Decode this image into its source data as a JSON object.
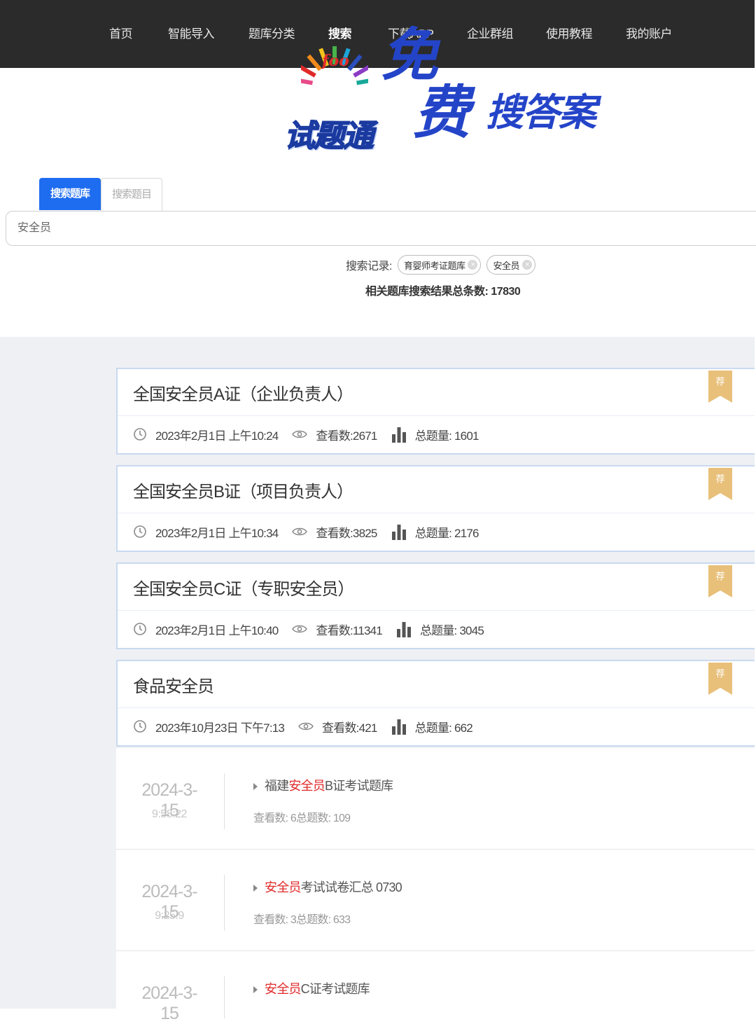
{
  "nav": {
    "items": [
      "首页",
      "智能导入",
      "题库分类",
      "搜索",
      "下载APP",
      "企业群组",
      "使用教程",
      "我的账户"
    ],
    "active_index": 3
  },
  "logo": {
    "brand_small": "foo",
    "brand_name": "试题通",
    "slogan_free_1": "免",
    "slogan_free_2": "费",
    "slogan_rest": "搜答案",
    "slogan_color": "#2444c8"
  },
  "search": {
    "tab_active": "搜索题库",
    "tab_inactive": "搜索题目",
    "query": "安全员",
    "history_label": "搜索记录:",
    "history": [
      "育婴师考证题库",
      "安全员"
    ],
    "total_label": "相关题库搜索结果总条数:",
    "total_value": "17830"
  },
  "featured": [
    {
      "title": "全国安全员A证（企业负责人）",
      "datetime": "2023年2月1日 上午10:24",
      "views": "查看数:2671",
      "count": "总题量:  1601",
      "badge": "荐"
    },
    {
      "title": "全国安全员B证（项目负责人）",
      "datetime": "2023年2月1日 上午10:34",
      "views": "查看数:3825",
      "count": "总题量:  2176",
      "badge": "荐"
    },
    {
      "title": "全国安全员C证（专职安全员）",
      "datetime": "2023年2月1日 上午10:40",
      "views": "查看数:11341",
      "count": "总题量:  3045",
      "badge": "荐"
    },
    {
      "title": "食品安全员",
      "datetime": "2023年10月23日 下午7:13",
      "views": "查看数:421",
      "count": "总题量:  662",
      "badge": "荐"
    }
  ],
  "results": [
    {
      "date": "2024-3-15",
      "time": "9:58:22",
      "prefix": "福建",
      "highlight": "安全员",
      "suffix": "B证考试题库",
      "meta": "查看数:  6总题数:  109"
    },
    {
      "date": "2024-3-15",
      "time": "9:25:9",
      "prefix": "",
      "highlight": "安全员",
      "suffix": "考试试卷汇总 0730",
      "meta": "查看数:  3总题数:  633"
    },
    {
      "date": "2024-3-15",
      "time": "",
      "prefix": "",
      "highlight": "安全员",
      "suffix": "C证考试题库",
      "meta": ""
    }
  ],
  "colors": {
    "nav_bg": "#2b2b2b",
    "tab_active": "#1e6cf0",
    "highlight": "#e02a2a",
    "badge": "#e8c07a",
    "card_border": "#c9d9f0"
  },
  "icons": {
    "clock": "clock-icon",
    "eye": "eye-icon",
    "bars": "bar-chart-icon",
    "bookmark": "bookmark-badge-icon",
    "close": "close-icon",
    "triangle": "triangle-right-icon"
  }
}
